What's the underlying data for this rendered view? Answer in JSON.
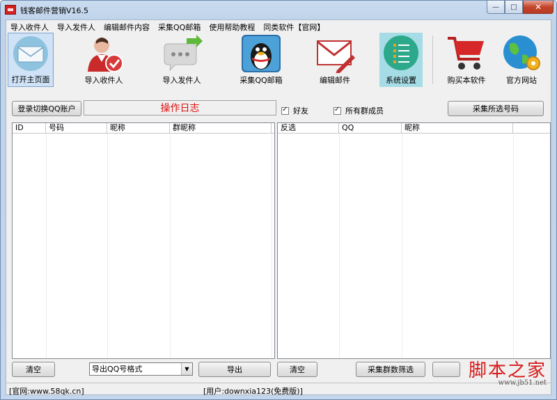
{
  "window": {
    "title": "钱客邮件营销V16.5",
    "controls": {
      "minimize": "—",
      "maximize": "□",
      "close": "✕"
    }
  },
  "menu": [
    "导入收件人",
    "导入发件人",
    "编辑邮件内容",
    "采集QQ邮箱",
    "使用帮助教程",
    "同类软件【官网】"
  ],
  "toolbar": [
    {
      "label": "打开主页面",
      "icon": "envelope-icon",
      "state": "active"
    },
    {
      "label": "导入收件人",
      "icon": "user-check-icon"
    },
    {
      "label": "导入发件人",
      "icon": "chat-bubble-arrow-icon"
    },
    {
      "label": "采集QQ邮箱",
      "icon": "qq-penguin-icon"
    },
    {
      "label": "编辑邮件",
      "icon": "envelope-pen-icon"
    },
    {
      "label": "系统设置",
      "icon": "settings-list-icon",
      "state": "highlighted"
    },
    {
      "label": "购买本软件",
      "icon": "shopping-cart-icon"
    },
    {
      "label": "官方网站",
      "icon": "globe-gear-icon"
    }
  ],
  "controls": {
    "login_button": "登录切换QQ账户",
    "log_title": "操作日志",
    "friends_checkbox": {
      "label": "好友",
      "checked": true
    },
    "members_checkbox": {
      "label": "所有群成员",
      "checked": true
    },
    "collect_selected_button": "采集所选号码"
  },
  "left_table": {
    "columns": [
      "ID",
      "号码",
      "昵称",
      "群昵称"
    ],
    "rows": []
  },
  "right_table": {
    "columns": [
      "反选",
      "QQ",
      "昵称"
    ],
    "rows": []
  },
  "bottom": {
    "clear_left": "清空",
    "export_format": "导出QQ号格式",
    "export_button": "导出",
    "clear_right": "清空",
    "filter_button": "采集群数筛选"
  },
  "status": {
    "website": "[官网:www.58qk.cn]",
    "user": "[用户:downxia123(免费版)]"
  },
  "watermark": {
    "main": "脚本之家",
    "sub": "www.jb51.net"
  },
  "colors": {
    "log_title": "#e01010",
    "watermark": "#d81a1a",
    "highlight": "#a6dce5"
  }
}
